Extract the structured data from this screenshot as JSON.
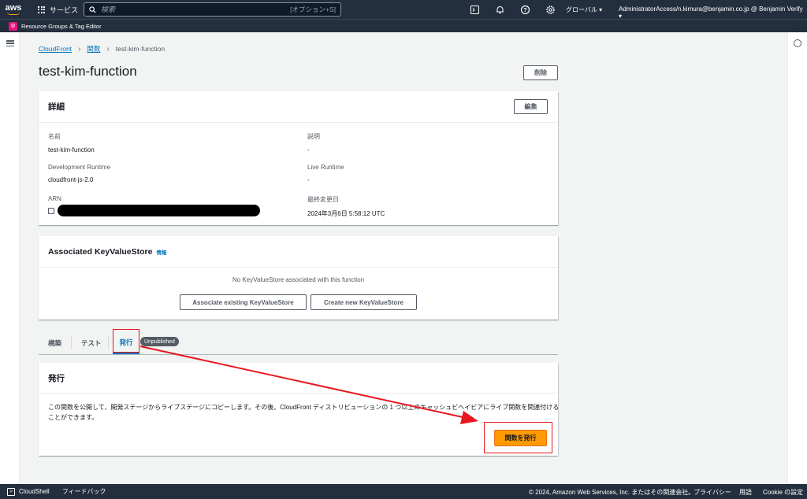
{
  "topnav": {
    "logo": "aws",
    "services_label": "サービス",
    "search_placeholder": "検索",
    "search_hint": "[オプション+S]",
    "icons": [
      "cloudshell-icon",
      "bell-icon",
      "help-icon",
      "settings-icon"
    ],
    "region": "グローバル ▾",
    "account": "AdministratorAccess/n.kimura@benjamin.co.jp @ Benjamin Verify ▾"
  },
  "subbar": {
    "label": "Resource Groups & Tag Editor"
  },
  "breadcrumb": {
    "items": [
      "CloudFront",
      "関数"
    ],
    "current": "test-kim-function"
  },
  "page": {
    "title": "test-kim-function",
    "delete_label": "削除"
  },
  "details": {
    "heading": "詳細",
    "edit_label": "編集",
    "name_key": "名前",
    "name_value": "test-kim-function",
    "desc_key": "説明",
    "desc_value": "-",
    "dev_runtime_key": "Development Runtime",
    "dev_runtime_value": "cloudfront-js-2.0",
    "live_runtime_key": "Live Runtime",
    "live_runtime_value": "-",
    "arn_key": "ARN",
    "modified_key": "最終変更日",
    "modified_value": "2024年3月6日 5:58:12 UTC"
  },
  "kvs": {
    "heading": "Associated KeyValueStore",
    "info": "情報",
    "empty": "No KeyValueStore associated with this function",
    "associate_label": "Associate existing KeyValueStore",
    "create_label": "Create new KeyValueStore"
  },
  "tabs": {
    "build": "構築",
    "test": "テスト",
    "publish": "発行",
    "badge": "Unpublished"
  },
  "publish": {
    "heading": "発行",
    "description": "この関数を公開して、開発ステージからライブステージにコピーします。その後、CloudFront ディストリビューションの 1 つ以上のキャッシュビヘイビアにライブ関数を関連付けることができます。",
    "button_label": "関数を発行"
  },
  "footer": {
    "cloudshell": "CloudShell",
    "feedback": "フィードバック",
    "copyright": "© 2024, Amazon Web Services, Inc. またはその関連会社。",
    "privacy": "プライバシー",
    "terms": "用語",
    "cookie": "Cookie の設定"
  },
  "colors": {
    "nav_bg": "#232f3e",
    "link": "#0073bb",
    "primary": "#ff9900",
    "highlight": "#e6191e"
  }
}
